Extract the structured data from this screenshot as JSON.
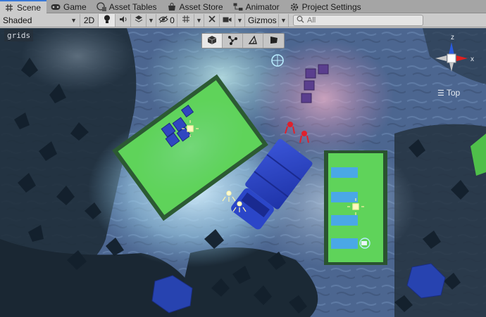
{
  "tabs": [
    {
      "label": "Scene",
      "icon": "grid-icon",
      "active": true
    },
    {
      "label": "Game",
      "icon": "gamepad-icon",
      "active": false
    },
    {
      "label": "Asset Tables",
      "icon": "asset-tables-icon",
      "active": false
    },
    {
      "label": "Asset Store",
      "icon": "store-icon",
      "active": false
    },
    {
      "label": "Animator",
      "icon": "animator-icon",
      "active": false
    },
    {
      "label": "Project Settings",
      "icon": "gear-icon",
      "active": false
    }
  ],
  "toolbar": {
    "draw_mode": "Shaded",
    "mode_2d": "2D",
    "hidden_count": "0",
    "gizmos": "Gizmos",
    "search_placeholder": "All"
  },
  "viewport": {
    "overlay_label": "grids",
    "orientation_label": "Top",
    "axis_z": "z",
    "axis_x": "x",
    "tools": [
      "cube-tool-icon",
      "node-tool-icon",
      "polygon-tool-icon",
      "flag-tool-icon"
    ]
  },
  "colors": {
    "tab_active_accent": "#3a79d8",
    "axis_x": "#e02020",
    "axis_z": "#2a5ce0",
    "platform_green": "#5fd35a",
    "tint_blue": "#3a5ad8"
  }
}
